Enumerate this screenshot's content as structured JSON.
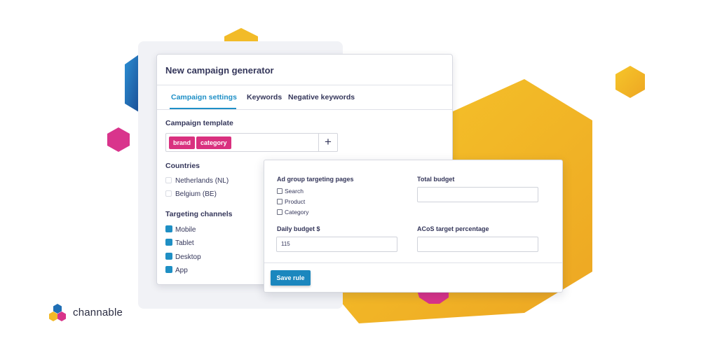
{
  "colors": {
    "accent_blue": "#1e8fc6",
    "tag_pink": "#d9317f",
    "hex_yellow": "#f2b928",
    "hex_blue": "#1f6fb5",
    "hex_pink": "#d8338a"
  },
  "panel": {
    "title": "New campaign generator",
    "tabs": [
      {
        "label": "Campaign settings",
        "active": true
      },
      {
        "label": "Keywords",
        "active": false
      },
      {
        "label": "Negative keywords",
        "active": false
      }
    ],
    "template": {
      "label": "Campaign template",
      "tags": [
        "brand",
        "category"
      ],
      "add_icon": "plus-icon"
    },
    "countries": {
      "label": "Countries",
      "items": [
        "Netherlands (NL)",
        "Belgium (BE)"
      ]
    },
    "channels": {
      "label": "Targeting channels",
      "items": [
        "Mobile",
        "Tablet",
        "Desktop",
        "App"
      ]
    }
  },
  "rule": {
    "targeting_label": "Ad group targeting pages",
    "targeting_options": [
      "Search",
      "Product",
      "Category"
    ],
    "total_budget_label": "Total budget",
    "total_budget_value": "",
    "daily_budget_label": "Daily budget $",
    "daily_budget_value": "115",
    "acos_label": "ACoS target percentage",
    "acos_value": "",
    "save_label": "Save rule"
  },
  "brand": {
    "name": "channable"
  }
}
